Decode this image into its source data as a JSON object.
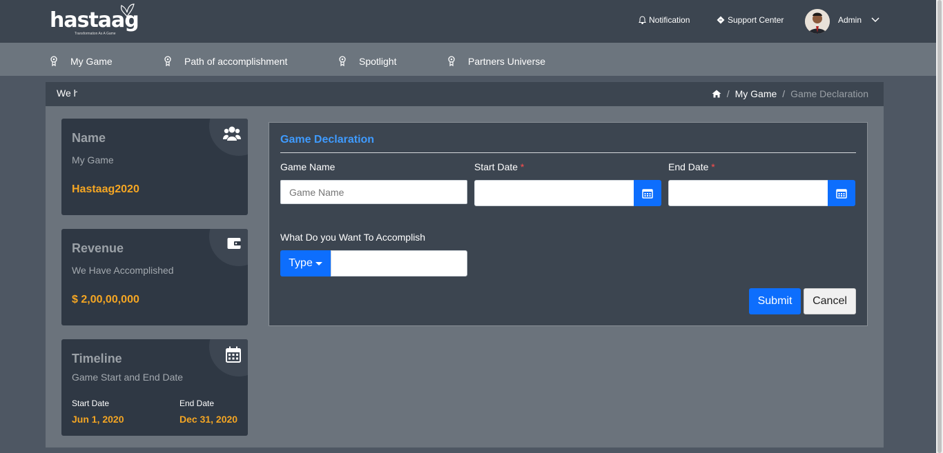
{
  "brand": {
    "name": "hastaag",
    "tagline": "Transformation As A Game"
  },
  "topbar": {
    "notification_label": "Notification",
    "support_label": "Support Center",
    "user_name": "Admin"
  },
  "nav": {
    "items": [
      {
        "label": "My Game"
      },
      {
        "label": "Path of accomplishment"
      },
      {
        "label": "Spotlight"
      },
      {
        "label": "Partners Universe"
      }
    ]
  },
  "marquee_text": "We h",
  "breadcrumb": {
    "items": [
      "My Game",
      "Game Declaration"
    ],
    "separator": "/"
  },
  "cards": {
    "name": {
      "title": "Name",
      "subtitle": "My Game",
      "value": "Hastaag2020"
    },
    "revenue": {
      "title": "Revenue",
      "subtitle": "We Have Accomplished",
      "value": "$ 2,00,00,000"
    },
    "timeline": {
      "title": "Timeline",
      "subtitle": "Game Start and End Date",
      "start_label": "Start Date",
      "start_value": "Jun 1, 2020",
      "end_label": "End Date",
      "end_value": "Dec 31, 2020"
    }
  },
  "form": {
    "title": "Game Declaration",
    "game_name_label": "Game Name",
    "game_name_placeholder": "Game Name",
    "game_name_value": "",
    "start_date_label": "Start Date",
    "start_date_value": "",
    "end_date_label": "End Date",
    "end_date_value": "",
    "required_mark": "*",
    "accomplish_label": "What Do you Want To Accomplish",
    "type_button_label": "Type",
    "accomplish_value": "",
    "submit_label": "Submit",
    "cancel_label": "Cancel"
  },
  "colors": {
    "accent": "#0d6efd",
    "title_blue": "#3f9bff",
    "value_orange": "#f5a623",
    "required_red": "#ff4d4d"
  }
}
